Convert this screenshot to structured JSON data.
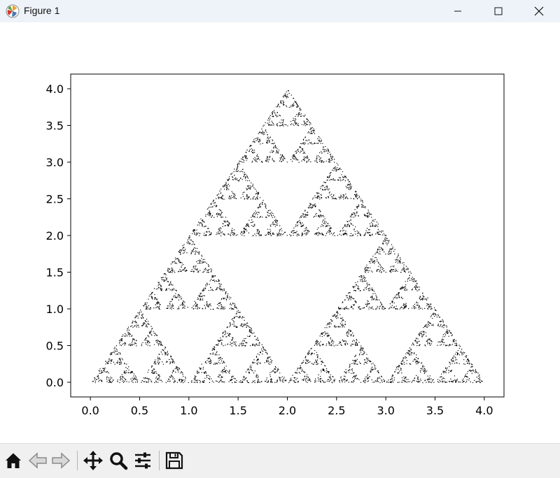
{
  "window": {
    "title": "Figure 1",
    "icon": "matplotlib-logo-icon",
    "controls": [
      "minimize-icon",
      "maximize-icon",
      "close-icon"
    ]
  },
  "toolbar": {
    "buttons": [
      {
        "name": "home-button",
        "icon": "home-icon"
      },
      {
        "name": "back-button",
        "icon": "back-arrow-icon"
      },
      {
        "name": "forward-button",
        "icon": "forward-arrow-icon"
      },
      {
        "name": "pan-button",
        "icon": "move-icon"
      },
      {
        "name": "zoom-button",
        "icon": "magnifier-icon"
      },
      {
        "name": "configure-subplots-button",
        "icon": "sliders-icon"
      },
      {
        "name": "save-button",
        "icon": "floppy-disk-icon"
      }
    ]
  },
  "chart_data": {
    "type": "scatter",
    "title": "",
    "xlabel": "",
    "ylabel": "",
    "description_of_points": "Sierpinski triangle point cloud",
    "vertices": [
      [
        0,
        0
      ],
      [
        4,
        0
      ],
      [
        2,
        4
      ]
    ],
    "recursion_depth": 5,
    "point_color": "#000000",
    "xlim": [
      -0.2,
      4.2
    ],
    "ylim": [
      -0.2,
      4.2
    ],
    "xticks": [
      0.0,
      0.5,
      1.0,
      1.5,
      2.0,
      2.5,
      3.0,
      3.5,
      4.0
    ],
    "xtick_labels": [
      "0.0",
      "0.5",
      "1.0",
      "1.5",
      "2.0",
      "2.5",
      "3.0",
      "3.5",
      "4.0"
    ],
    "yticks": [
      0.0,
      0.5,
      1.0,
      1.5,
      2.0,
      2.5,
      3.0,
      3.5,
      4.0
    ],
    "ytick_labels": [
      "0.0",
      "0.5",
      "1.0",
      "1.5",
      "2.0",
      "2.5",
      "3.0",
      "3.5",
      "4.0"
    ],
    "grid": false,
    "legend": false
  }
}
